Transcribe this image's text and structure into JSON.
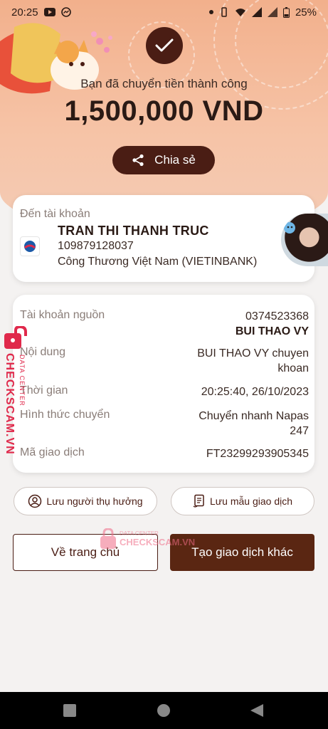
{
  "status_bar": {
    "time": "20:25",
    "battery": "25%"
  },
  "hero": {
    "success_text": "Bạn đã chuyển tiền thành công",
    "amount": "1,500,000 VND",
    "share_label": "Chia sẻ"
  },
  "recipient": {
    "to_label": "Đến tài khoản",
    "name": "TRAN THI THANH TRUC",
    "account_number": "109879128037",
    "bank": "Công Thương Việt Nam (VIETINBANK)"
  },
  "details": {
    "source_label": "Tài khoản nguồn",
    "source_account": "0374523368",
    "source_name": "BUI THAO VY",
    "content_label": "Nội dung",
    "content_line1": "BUI THAO VY chuyen",
    "content_line2": "khoan",
    "time_label": "Thời gian",
    "time_value": "20:25:40, 26/10/2023",
    "method_label": "Hình thức chuyển",
    "method_line1": "Chuyển nhanh Napas",
    "method_line2": "247",
    "code_label": "Mã giao dịch",
    "code_value": "FT23299293905345"
  },
  "buttons": {
    "save_beneficiary": "Lưu người thụ hưởng",
    "save_template": "Lưu mẫu giao dịch",
    "home": "Về trang chủ",
    "new_transaction": "Tạo giao dịch khác"
  },
  "watermark": {
    "side_text": "CHECKSCAM.VN",
    "side_sub": "DATA CENTER",
    "center_top": "DATA CENTER",
    "center_main": "CHECKSCAM.VN"
  },
  "colors": {
    "primary": "#4a1d14",
    "accent": "#5a2612",
    "hero": "#f2b08c",
    "watermark": "#e0294b"
  }
}
